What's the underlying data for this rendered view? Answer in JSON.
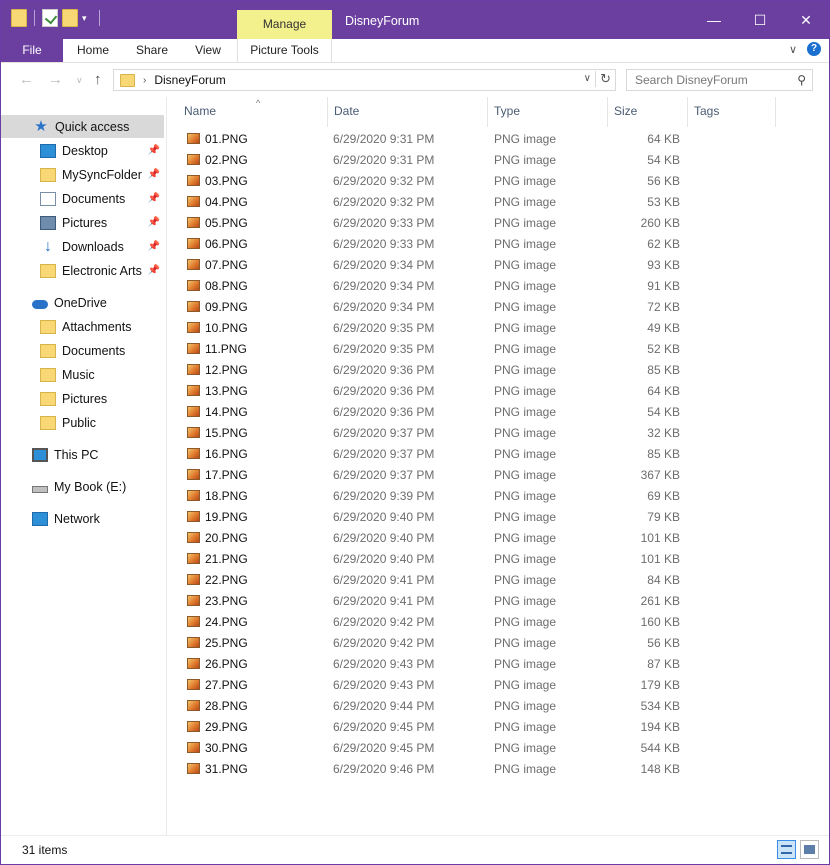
{
  "window": {
    "title": "DisneyForum",
    "contextual_tab": "Manage",
    "controls": {
      "minimize": "—",
      "maximize": "☐",
      "close": "✕"
    }
  },
  "ribbon": {
    "tabs": [
      "File",
      "Home",
      "Share",
      "View",
      "Picture Tools"
    ],
    "help": "?"
  },
  "address": {
    "path": "DisneyForum",
    "search_placeholder": "Search DisneyForum"
  },
  "sidebar": {
    "quick_access": "Quick access",
    "quick_items": [
      {
        "label": "Desktop",
        "icon": "desktop-icon",
        "pinned": true
      },
      {
        "label": "MySyncFolder",
        "icon": "folder-icon",
        "pinned": true
      },
      {
        "label": "Documents",
        "icon": "documents-icon",
        "pinned": true
      },
      {
        "label": "Pictures",
        "icon": "pictures-icon",
        "pinned": true
      },
      {
        "label": "Downloads",
        "icon": "downloads-icon",
        "pinned": true
      },
      {
        "label": "Electronic Arts",
        "icon": "folder-icon",
        "pinned": true
      }
    ],
    "onedrive": "OneDrive",
    "onedrive_items": [
      "Attachments",
      "Documents",
      "Music",
      "Pictures",
      "Public"
    ],
    "this_pc": "This PC",
    "drive": "My Book (E:)",
    "network": "Network"
  },
  "columns": {
    "name": "Name",
    "date": "Date",
    "type": "Type",
    "size": "Size",
    "tags": "Tags"
  },
  "files": [
    {
      "name": "01.PNG",
      "date": "6/29/2020 9:31 PM",
      "type": "PNG image",
      "size": "64 KB"
    },
    {
      "name": "02.PNG",
      "date": "6/29/2020 9:31 PM",
      "type": "PNG image",
      "size": "54 KB"
    },
    {
      "name": "03.PNG",
      "date": "6/29/2020 9:32 PM",
      "type": "PNG image",
      "size": "56 KB"
    },
    {
      "name": "04.PNG",
      "date": "6/29/2020 9:32 PM",
      "type": "PNG image",
      "size": "53 KB"
    },
    {
      "name": "05.PNG",
      "date": "6/29/2020 9:33 PM",
      "type": "PNG image",
      "size": "260 KB"
    },
    {
      "name": "06.PNG",
      "date": "6/29/2020 9:33 PM",
      "type": "PNG image",
      "size": "62 KB"
    },
    {
      "name": "07.PNG",
      "date": "6/29/2020 9:34 PM",
      "type": "PNG image",
      "size": "93 KB"
    },
    {
      "name": "08.PNG",
      "date": "6/29/2020 9:34 PM",
      "type": "PNG image",
      "size": "91 KB"
    },
    {
      "name": "09.PNG",
      "date": "6/29/2020 9:34 PM",
      "type": "PNG image",
      "size": "72 KB"
    },
    {
      "name": "10.PNG",
      "date": "6/29/2020 9:35 PM",
      "type": "PNG image",
      "size": "49 KB"
    },
    {
      "name": "11.PNG",
      "date": "6/29/2020 9:35 PM",
      "type": "PNG image",
      "size": "52 KB"
    },
    {
      "name": "12.PNG",
      "date": "6/29/2020 9:36 PM",
      "type": "PNG image",
      "size": "85 KB"
    },
    {
      "name": "13.PNG",
      "date": "6/29/2020 9:36 PM",
      "type": "PNG image",
      "size": "64 KB"
    },
    {
      "name": "14.PNG",
      "date": "6/29/2020 9:36 PM",
      "type": "PNG image",
      "size": "54 KB"
    },
    {
      "name": "15.PNG",
      "date": "6/29/2020 9:37 PM",
      "type": "PNG image",
      "size": "32 KB"
    },
    {
      "name": "16.PNG",
      "date": "6/29/2020 9:37 PM",
      "type": "PNG image",
      "size": "85 KB"
    },
    {
      "name": "17.PNG",
      "date": "6/29/2020 9:37 PM",
      "type": "PNG image",
      "size": "367 KB"
    },
    {
      "name": "18.PNG",
      "date": "6/29/2020 9:39 PM",
      "type": "PNG image",
      "size": "69 KB"
    },
    {
      "name": "19.PNG",
      "date": "6/29/2020 9:40 PM",
      "type": "PNG image",
      "size": "79 KB"
    },
    {
      "name": "20.PNG",
      "date": "6/29/2020 9:40 PM",
      "type": "PNG image",
      "size": "101 KB"
    },
    {
      "name": "21.PNG",
      "date": "6/29/2020 9:40 PM",
      "type": "PNG image",
      "size": "101 KB"
    },
    {
      "name": "22.PNG",
      "date": "6/29/2020 9:41 PM",
      "type": "PNG image",
      "size": "84 KB"
    },
    {
      "name": "23.PNG",
      "date": "6/29/2020 9:41 PM",
      "type": "PNG image",
      "size": "261 KB"
    },
    {
      "name": "24.PNG",
      "date": "6/29/2020 9:42 PM",
      "type": "PNG image",
      "size": "160 KB"
    },
    {
      "name": "25.PNG",
      "date": "6/29/2020 9:42 PM",
      "type": "PNG image",
      "size": "56 KB"
    },
    {
      "name": "26.PNG",
      "date": "6/29/2020 9:43 PM",
      "type": "PNG image",
      "size": "87 KB"
    },
    {
      "name": "27.PNG",
      "date": "6/29/2020 9:43 PM",
      "type": "PNG image",
      "size": "179 KB"
    },
    {
      "name": "28.PNG",
      "date": "6/29/2020 9:44 PM",
      "type": "PNG image",
      "size": "534 KB"
    },
    {
      "name": "29.PNG",
      "date": "6/29/2020 9:45 PM",
      "type": "PNG image",
      "size": "194 KB"
    },
    {
      "name": "30.PNG",
      "date": "6/29/2020 9:45 PM",
      "type": "PNG image",
      "size": "544 KB"
    },
    {
      "name": "31.PNG",
      "date": "6/29/2020 9:46 PM",
      "type": "PNG image",
      "size": "148 KB"
    }
  ],
  "status": {
    "item_count": "31 items"
  },
  "colors": {
    "accent": "#6b3fa0",
    "manage_tab": "#f3f08e",
    "selection": "#d9d9d9"
  }
}
